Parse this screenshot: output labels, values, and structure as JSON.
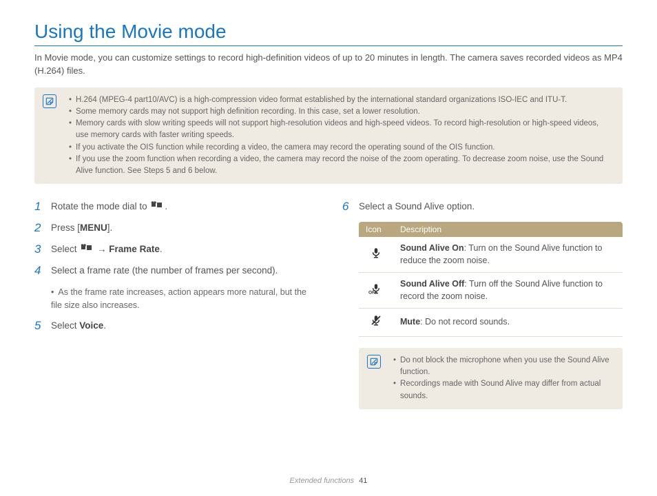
{
  "title": "Using the Movie mode",
  "intro": "In Movie mode, you can customize settings to record high-definition videos of up to 20 minutes in length. The camera saves recorded videos as MP4 (H.264) files.",
  "topNotes": [
    "H.264 (MPEG-4 part10/AVC) is a high-compression video format established by the international standard organizations ISO-IEC and ITU-T.",
    "Some memory cards may not support high definition recording. In this case, set a lower resolution.",
    "Memory cards with slow writing speeds will not support high-resolution videos and high-speed videos. To record high-resolution or high-speed videos, use memory cards with faster writing speeds.",
    "If you activate the OIS function while recording a video, the camera may record the operating sound of the OIS function.",
    "If you use the zoom function when recording a video, the camera may record the noise of the zoom operating. To decrease zoom noise, use the Sound Alive function. See Steps 5 and 6 below."
  ],
  "steps": {
    "s1_pre": "Rotate the mode dial to ",
    "s1_post": ".",
    "s2_pre": "Press [",
    "s2_bold": "MENU",
    "s2_post": "].",
    "s3_pre": "Select ",
    "s3_arrow": " → ",
    "s3_bold": "Frame Rate",
    "s3_post": ".",
    "s4": "Select a frame rate (the number of frames per second).",
    "s4_sub": "As the frame rate increases, action appears more natural, but the file size also increases.",
    "s5_pre": "Select ",
    "s5_bold": "Voice",
    "s5_post": ".",
    "s6": "Select a Sound Alive option."
  },
  "table": {
    "headers": {
      "icon": "Icon",
      "desc": "Description"
    },
    "rows": [
      {
        "bold": "Sound Alive On",
        "rest": ": Turn on the Sound Alive function to reduce the zoom noise."
      },
      {
        "bold": "Sound Alive Off",
        "rest": ": Turn off the Sound Alive function to record the zoom noise."
      },
      {
        "bold": "Mute",
        "rest": ": Do not record sounds."
      }
    ]
  },
  "bottomNotes": [
    "Do not block the microphone when you use the Sound Alive function.",
    "Recordings made with Sound Alive may differ from actual sounds."
  ],
  "footer": {
    "section": "Extended functions",
    "page": "41"
  }
}
